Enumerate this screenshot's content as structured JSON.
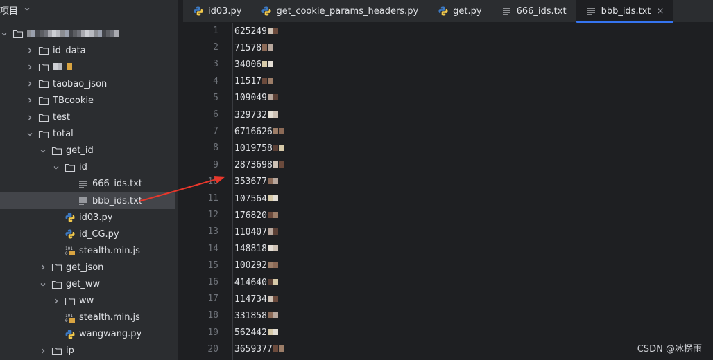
{
  "project": {
    "header_label": "项目",
    "rows": [
      {
        "depth": 0,
        "arrow": "down",
        "icon": "folder-icon",
        "label": "",
        "blurred": true
      },
      {
        "depth": 1,
        "arrow": "right",
        "icon": "folder-icon",
        "label": "id_data"
      },
      {
        "depth": 1,
        "arrow": "right",
        "icon": "folder-icon",
        "label": "",
        "blurred": true
      },
      {
        "depth": 1,
        "arrow": "right",
        "icon": "folder-icon",
        "label": "taobao_json"
      },
      {
        "depth": 1,
        "arrow": "right",
        "icon": "folder-icon",
        "label": "TBcookie"
      },
      {
        "depth": 1,
        "arrow": "right",
        "icon": "folder-icon",
        "label": "test"
      },
      {
        "depth": 1,
        "arrow": "down",
        "icon": "folder-icon",
        "label": "total"
      },
      {
        "depth": 2,
        "arrow": "down",
        "icon": "folder-icon",
        "label": "get_id"
      },
      {
        "depth": 3,
        "arrow": "down",
        "icon": "folder-icon",
        "label": "id"
      },
      {
        "depth": 4,
        "arrow": "none",
        "icon": "text-file-icon",
        "label": "666_ids.txt"
      },
      {
        "depth": 4,
        "arrow": "none",
        "icon": "text-file-icon",
        "label": "bbb_ids.txt",
        "selected": true
      },
      {
        "depth": 3,
        "arrow": "none",
        "icon": "python-icon",
        "label": "id03.py"
      },
      {
        "depth": 3,
        "arrow": "none",
        "icon": "python-icon",
        "label": "id_CG.py"
      },
      {
        "depth": 3,
        "arrow": "none",
        "icon": "js-file-icon",
        "label": "stealth.min.js"
      },
      {
        "depth": 2,
        "arrow": "right",
        "icon": "folder-icon",
        "label": "get_json"
      },
      {
        "depth": 2,
        "arrow": "down",
        "icon": "folder-icon",
        "label": "get_ww"
      },
      {
        "depth": 3,
        "arrow": "right",
        "icon": "folder-icon",
        "label": "ww"
      },
      {
        "depth": 3,
        "arrow": "none",
        "icon": "js-file-icon",
        "label": "stealth.min.js"
      },
      {
        "depth": 3,
        "arrow": "none",
        "icon": "python-icon",
        "label": "wangwang.py"
      },
      {
        "depth": 2,
        "arrow": "right",
        "icon": "folder-icon",
        "label": "ip"
      }
    ]
  },
  "tabs": [
    {
      "label": "id03.py",
      "icon": "python-icon",
      "active": false
    },
    {
      "label": "get_cookie_params_headers.py",
      "icon": "python-icon",
      "active": false
    },
    {
      "label": "get.py",
      "icon": "python-icon",
      "active": false
    },
    {
      "label": "666_ids.txt",
      "icon": "text-file-icon",
      "active": false
    },
    {
      "label": "bbb_ids.txt",
      "icon": "text-file-icon",
      "active": true,
      "close": "×"
    }
  ],
  "editor": {
    "lines": [
      {
        "n": "1",
        "text": "625249"
      },
      {
        "n": "2",
        "text": "71578"
      },
      {
        "n": "3",
        "text": "34006"
      },
      {
        "n": "4",
        "text": "11517"
      },
      {
        "n": "5",
        "text": "109049"
      },
      {
        "n": "6",
        "text": "329732"
      },
      {
        "n": "7",
        "text": "6716626"
      },
      {
        "n": "8",
        "text": "1019758"
      },
      {
        "n": "9",
        "text": "2873698"
      },
      {
        "n": "10",
        "text": "353677"
      },
      {
        "n": "11",
        "text": "107564"
      },
      {
        "n": "12",
        "text": "176820"
      },
      {
        "n": "13",
        "text": "110407"
      },
      {
        "n": "14",
        "text": "148818"
      },
      {
        "n": "15",
        "text": "100292"
      },
      {
        "n": "16",
        "text": "414640"
      },
      {
        "n": "17",
        "text": "114734"
      },
      {
        "n": "18",
        "text": "331858"
      },
      {
        "n": "19",
        "text": "562442"
      },
      {
        "n": "20",
        "text": "3659377"
      }
    ]
  },
  "watermark": "CSDN @冰楞雨",
  "colors": {
    "accent": "#3574f0",
    "annotation_arrow": "#e8372b"
  }
}
